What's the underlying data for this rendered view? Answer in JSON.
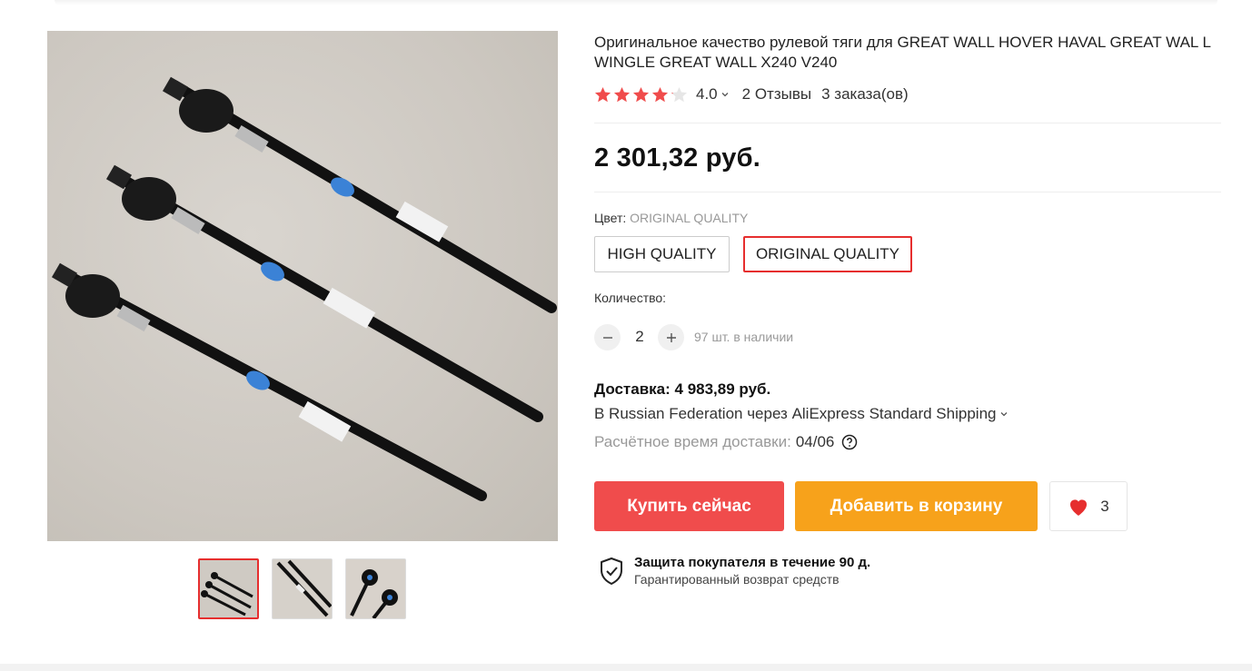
{
  "product": {
    "title": "Оригинальное качество рулевой тяги для GREAT WALL HOVER HAVAL GREAT WAL L WINGLE GREAT WALL X240 V240",
    "rating": "4.0",
    "reviews": "2 Отзывы",
    "orders": "3 заказа(ов)",
    "price": "2 301,32 руб."
  },
  "color": {
    "label": "Цвет:",
    "selected": "ORIGINAL QUALITY",
    "options": [
      "HIGH QUALITY",
      "ORIGINAL QUALITY"
    ]
  },
  "quantity": {
    "label": "Количество:",
    "value": "2",
    "stock": "97 шт. в наличии"
  },
  "shipping": {
    "price": "Доставка: 4 983,89 руб.",
    "via": "В Russian Federation через AliExpress Standard Shipping",
    "eta_label": "Расчётное время доставки:",
    "eta_date": "04/06"
  },
  "actions": {
    "buy_now": "Купить сейчас",
    "add_to_cart": "Добавить в корзину",
    "wishlist_count": "3"
  },
  "protection": {
    "title": "Защита покупателя в течение 90 д.",
    "subtitle": "Гарантированный возврат средств"
  },
  "colors": {
    "accent_red": "#f04c4c",
    "accent_orange": "#f7a21b",
    "star": "#f04c4c"
  },
  "icons": [
    "star-icon",
    "chevron-down-icon",
    "minus-icon",
    "plus-icon",
    "help-icon",
    "heart-icon",
    "shield-check-icon"
  ]
}
